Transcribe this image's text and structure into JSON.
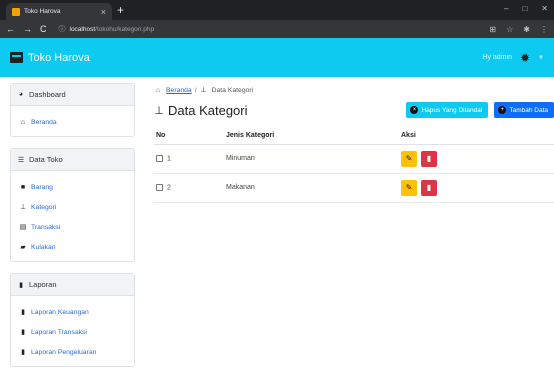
{
  "browser": {
    "tab_title": "Toko Harova",
    "tab_close": "×",
    "new_tab": "+",
    "back": "←",
    "forward": "→",
    "reload": "C",
    "url_host": "localhost",
    "url_path": "/tokohu/kategori.php",
    "win_min": "‒",
    "win_max": "□",
    "win_close": "✕"
  },
  "navbar": {
    "brand": "Toko Harova",
    "user": "Hy admin",
    "bg_color": "#0dcaf0"
  },
  "sidebar": {
    "sections": [
      {
        "title": "Dashboard",
        "items": [
          {
            "label": "Beranda",
            "icon": "home-icon"
          }
        ]
      },
      {
        "title": "Data Toko",
        "items": [
          {
            "label": "Barang",
            "icon": "box-icon"
          },
          {
            "label": "Kategori",
            "icon": "sitemap-icon"
          },
          {
            "label": "Transaksi",
            "icon": "cash-register-icon"
          },
          {
            "label": "Kulakan",
            "icon": "truck-icon"
          }
        ]
      },
      {
        "title": "Laporan",
        "items": [
          {
            "label": "Laporan Keuangan",
            "icon": "file-icon"
          },
          {
            "label": "Laporan Transaksi",
            "icon": "file-icon"
          },
          {
            "label": "Laporan Pengeluaran",
            "icon": "file-icon"
          }
        ]
      }
    ]
  },
  "main": {
    "breadcrumb": {
      "home": "Beranda",
      "sep": "/",
      "current": "Data Kategori"
    },
    "title": "Data Kategori",
    "buttons": {
      "restore": "Hapus Yang Ditandai",
      "add": "Tambah Data"
    },
    "table": {
      "headers": [
        "No",
        "Jenis Kategori",
        "Aksi"
      ],
      "rows": [
        {
          "no": "1",
          "jenis": "Minuman"
        },
        {
          "no": "2",
          "jenis": "Makanan"
        }
      ]
    }
  }
}
